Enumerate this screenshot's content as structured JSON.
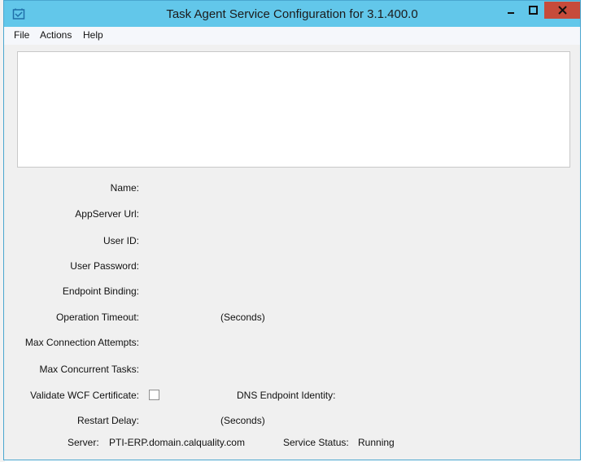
{
  "window": {
    "title": "Task Agent Service Configuration for 3.1.400.0"
  },
  "menu": [
    "File",
    "Actions",
    "Help"
  ],
  "form": {
    "labels": {
      "name": "Name:",
      "appserver_url": "AppServer Url:",
      "user_id": "User ID:",
      "user_password": "User Password:",
      "endpoint_binding": "Endpoint Binding:",
      "operation_timeout": "Operation Timeout:",
      "max_connection_attempts": "Max Connection Attempts:",
      "max_concurrent_tasks": "Max Concurrent Tasks:",
      "validate_wcf_certificate": "Validate WCF Certificate:",
      "restart_delay": "Restart Delay:"
    },
    "operation_timeout_unit": "(Seconds)",
    "restart_delay_unit": "(Seconds)",
    "dns_endpoint_identity_label": "DNS Endpoint Identity:",
    "validate_wcf_certificate_checked": false
  },
  "status": {
    "server_label": "Server:",
    "server_value": "PTI-ERP.domain.calquality.com",
    "service_status_label": "Service Status:",
    "service_status_value": "Running"
  },
  "colors": {
    "titlebar": "#62c7ea",
    "close_button": "#c74b3b",
    "window_body": "#f0f0f0"
  }
}
